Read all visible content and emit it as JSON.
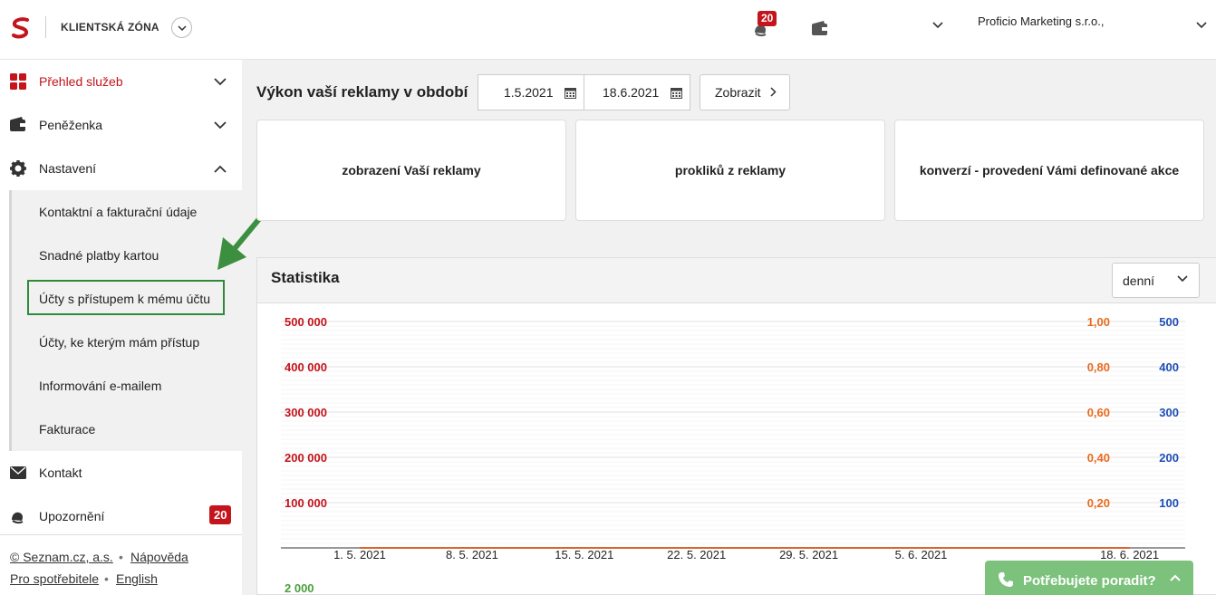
{
  "header": {
    "zone_title": "KLIENTSKÁ ZÓNA",
    "notification_count": "20",
    "account_name": "Proficio Marketing s.r.o.,"
  },
  "sidebar": {
    "items": [
      {
        "label": "Přehled služeb",
        "icon": "grid-icon"
      },
      {
        "label": "Peněženka",
        "icon": "wallet-icon"
      },
      {
        "label": "Nastavení",
        "icon": "gear-icon"
      }
    ],
    "submenu": [
      "Kontaktní a fakturační údaje",
      "Snadné platby kartou",
      "Účty s přístupem k mému účtu",
      "Účty, ke kterým mám přístup",
      "Informování e-mailem",
      "Fakturace"
    ],
    "contact_label": "Kontakt",
    "alerts_label": "Upozornění",
    "alerts_count": "20"
  },
  "footer": {
    "copyright": "© Seznam.cz, a.s.",
    "help": "Nápověda",
    "consumers": "Pro spotřebitele",
    "language": "English"
  },
  "main": {
    "period_title": "Výkon vaší reklamy v období",
    "date_from": "1.5.2021",
    "date_to": "18.6.2021",
    "show_button": "Zobrazit",
    "cards": [
      "zobrazení Vaší reklamy",
      "prokliků z reklamy",
      "konverzí - provedení Vámi definované akce"
    ],
    "stats_title": "Statistika",
    "period_select": "denní",
    "help_button": "Potřebujete poradit?"
  },
  "colors": {
    "brand_red": "#c4141c",
    "blue": "#1f4fb5",
    "orange": "#e86a1c",
    "green": "#4aa03c"
  },
  "chart_data": {
    "type": "line",
    "x_tick_labels": [
      "1. 5. 2021",
      "8. 5. 2021",
      "15. 5. 2021",
      "22. 5. 2021",
      "29. 5. 2021",
      "5. 6. 2021",
      "18. 6. 2021"
    ],
    "left_axis": {
      "ticks": [
        "100 000",
        "200 000",
        "300 000",
        "400 000",
        "500 000"
      ],
      "color": "#c4141c"
    },
    "right_axis_orange": {
      "ticks": [
        "0,20",
        "0,40",
        "0,60",
        "0,80",
        "1,00"
      ],
      "color": "#e86a1c"
    },
    "right_axis_blue": {
      "ticks": [
        "100",
        "200",
        "300",
        "400",
        "500"
      ],
      "color": "#1f4fb5"
    },
    "lower_chart_top_tick": "2 000",
    "x": [
      "2021-05-01",
      "2021-05-02",
      "2021-05-03",
      "2021-05-04",
      "2021-05-05",
      "2021-05-06",
      "2021-05-07",
      "2021-05-08",
      "2021-05-09",
      "2021-05-10",
      "2021-05-11",
      "2021-05-12",
      "2021-05-13",
      "2021-05-14",
      "2021-05-15",
      "2021-05-16",
      "2021-05-17",
      "2021-05-18",
      "2021-05-19",
      "2021-05-20",
      "2021-05-21",
      "2021-05-22",
      "2021-05-23",
      "2021-05-24",
      "2021-05-25",
      "2021-05-26",
      "2021-05-27",
      "2021-05-28",
      "2021-05-29",
      "2021-05-30",
      "2021-05-31",
      "2021-06-01",
      "2021-06-02",
      "2021-06-03",
      "2021-06-04",
      "2021-06-05",
      "2021-06-06",
      "2021-06-07",
      "2021-06-08",
      "2021-06-09",
      "2021-06-10",
      "2021-06-11",
      "2021-06-12",
      "2021-06-13",
      "2021-06-14",
      "2021-06-15",
      "2021-06-16",
      "2021-06-17",
      "2021-06-18"
    ],
    "series": [
      {
        "axis": "blue",
        "color": "#1f4fb5",
        "values": [
          0,
          0,
          0,
          0,
          0,
          0,
          0,
          0,
          0,
          0,
          0,
          0,
          0,
          0,
          0,
          0,
          0,
          0,
          0,
          0,
          0,
          0,
          0,
          0,
          0,
          0,
          0,
          0,
          0,
          0,
          0,
          0,
          0,
          0,
          0,
          0,
          0,
          0,
          0,
          0,
          0,
          0,
          0,
          0,
          0,
          0,
          0,
          0,
          0
        ]
      },
      {
        "axis": "left",
        "color": "#c4141c",
        "values": [
          0,
          0,
          0,
          0,
          0,
          0,
          0,
          0,
          0,
          0,
          0,
          0,
          0,
          0,
          0,
          0,
          0,
          0,
          0,
          0,
          0,
          0,
          0,
          0,
          0,
          0,
          0,
          0,
          0,
          0,
          0,
          0,
          0,
          0,
          0,
          0,
          0,
          0,
          0,
          0,
          0,
          0,
          0,
          0,
          0,
          0,
          0,
          0,
          0
        ]
      },
      {
        "axis": "orange",
        "color": "#e86a1c",
        "values": [
          0,
          0,
          0,
          0,
          0,
          0,
          0,
          0,
          0,
          0,
          0,
          0,
          0,
          0,
          0,
          0,
          0,
          0,
          0,
          0,
          0,
          0,
          0,
          0,
          0,
          0,
          0,
          0,
          0,
          0,
          0,
          0,
          0,
          0,
          0,
          0,
          0,
          0,
          0,
          0,
          0,
          0,
          0,
          0,
          0,
          0,
          0,
          0,
          0
        ]
      }
    ]
  }
}
